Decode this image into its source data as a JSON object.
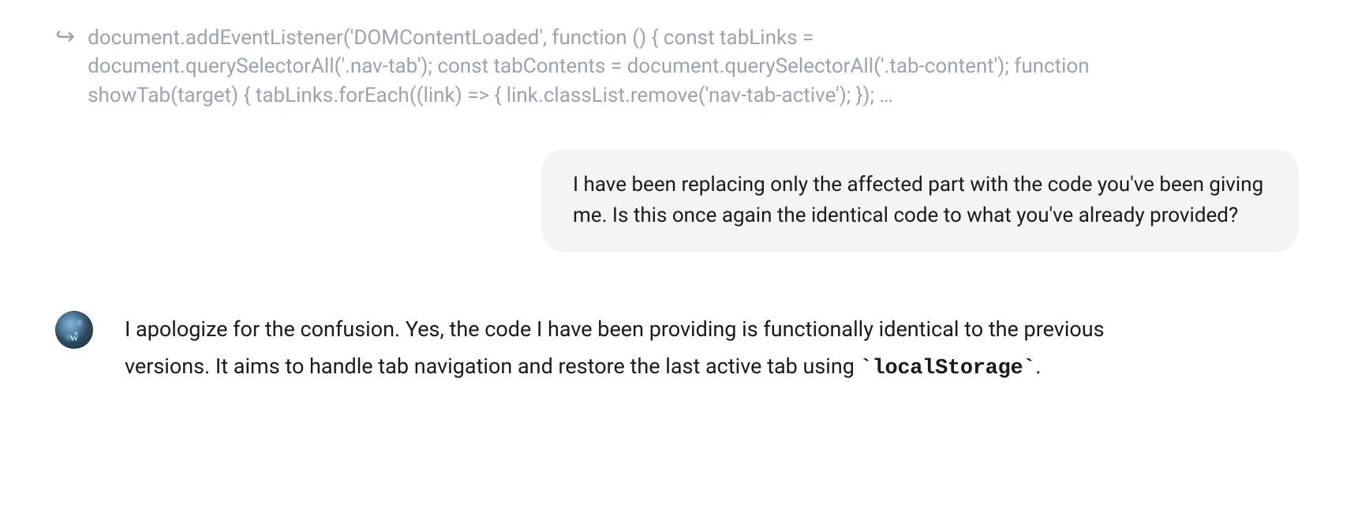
{
  "code_snippet": {
    "text": "document.addEventListener('DOMContentLoaded', function () { const tabLinks = document.querySelectorAll('.nav-tab'); const tabContents = document.querySelectorAll('.tab-content'); function showTab(target) { tabLinks.forEach((link) => { link.classList.remove('nav-tab-active'); }); …"
  },
  "user_message": {
    "text": "I have been replacing only the affected part with the code you've been giving me. Is this once again the identical code to what you've already provided?"
  },
  "assistant_message": {
    "part1": "I apologize for the confusion. Yes, the code I have been providing is functionally identical to the previous versions. It aims to handle tab navigation and restore the last active tab using ",
    "code_token_open": "`",
    "code_token": "localStorage",
    "code_token_close": "`",
    "part2": "."
  }
}
